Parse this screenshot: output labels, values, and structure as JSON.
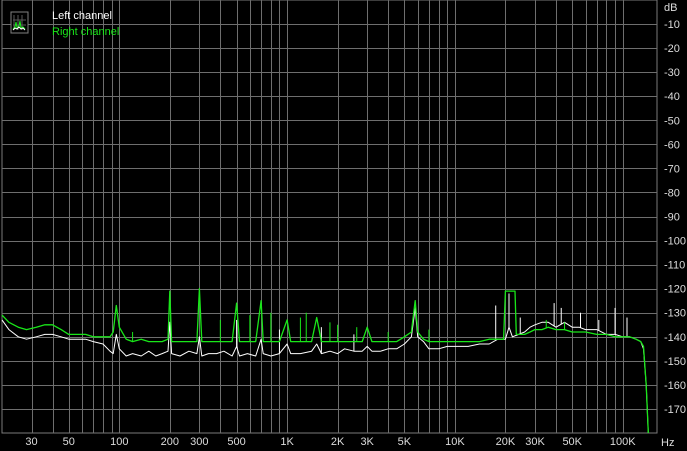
{
  "chart_data": {
    "type": "line",
    "x_scale": "log",
    "xlim": [
      20,
      160000
    ],
    "ylim": [
      -180,
      0
    ],
    "grid": true,
    "legend_placement": "top-left",
    "x_unit": "Hz",
    "y_unit": "dB",
    "x_ticks": [
      {
        "value": 30,
        "label": "30"
      },
      {
        "value": 50,
        "label": "50"
      },
      {
        "value": 100,
        "label": "100"
      },
      {
        "value": 200,
        "label": "200"
      },
      {
        "value": 300,
        "label": "300"
      },
      {
        "value": 500,
        "label": "500"
      },
      {
        "value": 1000,
        "label": "1K"
      },
      {
        "value": 2000,
        "label": "2K"
      },
      {
        "value": 3000,
        "label": "3K"
      },
      {
        "value": 5000,
        "label": "5K"
      },
      {
        "value": 10000,
        "label": "10K"
      },
      {
        "value": 20000,
        "label": "20K"
      },
      {
        "value": 30000,
        "label": "30K"
      },
      {
        "value": 50000,
        "label": "50K"
      },
      {
        "value": 100000,
        "label": "100K"
      }
    ],
    "y_ticks": [
      {
        "value": -10,
        "label": "-10"
      },
      {
        "value": -20,
        "label": "-20"
      },
      {
        "value": -30,
        "label": "-30"
      },
      {
        "value": -40,
        "label": "-40"
      },
      {
        "value": -50,
        "label": "-50"
      },
      {
        "value": -60,
        "label": "-60"
      },
      {
        "value": -70,
        "label": "-70"
      },
      {
        "value": -80,
        "label": "-80"
      },
      {
        "value": -90,
        "label": "-90"
      },
      {
        "value": -100,
        "label": "-100"
      },
      {
        "value": -110,
        "label": "-110"
      },
      {
        "value": -120,
        "label": "-120"
      },
      {
        "value": -130,
        "label": "-130"
      },
      {
        "value": -140,
        "label": "-140"
      },
      {
        "value": -150,
        "label": "-150"
      },
      {
        "value": -160,
        "label": "-160"
      },
      {
        "value": -170,
        "label": "-170"
      }
    ],
    "series": [
      {
        "name": "Left channel",
        "color": "#ffffff",
        "points": [
          [
            20,
            -133
          ],
          [
            22,
            -137
          ],
          [
            25,
            -140
          ],
          [
            28,
            -141
          ],
          [
            32,
            -140
          ],
          [
            36,
            -139
          ],
          [
            40,
            -139
          ],
          [
            45,
            -140
          ],
          [
            50,
            -141
          ],
          [
            56,
            -141
          ],
          [
            63,
            -141
          ],
          [
            70,
            -142
          ],
          [
            80,
            -143
          ],
          [
            88,
            -146
          ],
          [
            92,
            -147
          ],
          [
            96,
            -139
          ],
          [
            100,
            -145
          ],
          [
            110,
            -148
          ],
          [
            120,
            -147
          ],
          [
            135,
            -148
          ],
          [
            150,
            -146
          ],
          [
            165,
            -148
          ],
          [
            180,
            -147
          ],
          [
            195,
            -146
          ],
          [
            200,
            -134
          ],
          [
            205,
            -147
          ],
          [
            230,
            -148
          ],
          [
            260,
            -146
          ],
          [
            290,
            -147
          ],
          [
            300,
            -140
          ],
          [
            310,
            -148
          ],
          [
            340,
            -147
          ],
          [
            380,
            -147
          ],
          [
            420,
            -146
          ],
          [
            470,
            -148
          ],
          [
            500,
            -144
          ],
          [
            520,
            -148
          ],
          [
            580,
            -147
          ],
          [
            650,
            -148
          ],
          [
            700,
            -141
          ],
          [
            720,
            -147
          ],
          [
            800,
            -148
          ],
          [
            900,
            -147
          ],
          [
            1000,
            -143
          ],
          [
            1050,
            -147
          ],
          [
            1200,
            -147
          ],
          [
            1400,
            -146
          ],
          [
            1500,
            -143
          ],
          [
            1600,
            -147
          ],
          [
            1800,
            -146
          ],
          [
            2000,
            -147
          ],
          [
            2200,
            -145
          ],
          [
            2500,
            -146
          ],
          [
            2800,
            -146
          ],
          [
            3000,
            -144
          ],
          [
            3200,
            -146
          ],
          [
            3600,
            -146
          ],
          [
            4000,
            -145
          ],
          [
            4500,
            -145
          ],
          [
            5000,
            -143
          ],
          [
            5500,
            -140
          ],
          [
            5800,
            -128
          ],
          [
            6000,
            -140
          ],
          [
            6500,
            -142
          ],
          [
            7000,
            -145
          ],
          [
            8000,
            -145
          ],
          [
            9000,
            -144
          ],
          [
            10000,
            -144
          ],
          [
            12000,
            -144
          ],
          [
            14000,
            -143
          ],
          [
            16000,
            -143
          ],
          [
            18000,
            -141
          ],
          [
            20000,
            -141
          ],
          [
            21000,
            -136
          ],
          [
            22000,
            -140
          ],
          [
            24000,
            -139
          ],
          [
            26000,
            -138
          ],
          [
            28000,
            -136
          ],
          [
            30000,
            -135
          ],
          [
            33000,
            -134
          ],
          [
            36000,
            -134
          ],
          [
            40000,
            -136
          ],
          [
            45000,
            -134
          ],
          [
            50000,
            -136
          ],
          [
            55000,
            -136
          ],
          [
            60000,
            -137
          ],
          [
            70000,
            -137
          ],
          [
            80000,
            -139
          ],
          [
            90000,
            -139
          ],
          [
            100000,
            -140
          ],
          [
            110000,
            -140
          ],
          [
            120000,
            -141
          ],
          [
            128000,
            -142
          ],
          [
            133000,
            -145
          ],
          [
            138000,
            -160
          ],
          [
            142000,
            -180
          ]
        ],
        "spikes": [
          {
            "f": 500,
            "db": -133
          },
          {
            "f": 900,
            "db": -137
          },
          {
            "f": 1600,
            "db": -136
          },
          {
            "f": 2500,
            "db": -139
          },
          {
            "f": 5800,
            "db": -127
          },
          {
            "f": 17500,
            "db": -127
          },
          {
            "f": 21000,
            "db": -122
          },
          {
            "f": 24500,
            "db": -132
          },
          {
            "f": 39000,
            "db": -126
          },
          {
            "f": 43000,
            "db": -128
          },
          {
            "f": 56000,
            "db": -130
          },
          {
            "f": 72000,
            "db": -133
          },
          {
            "f": 90000,
            "db": -128
          },
          {
            "f": 106000,
            "db": -132
          }
        ]
      },
      {
        "name": "Right channel",
        "color": "#19e619",
        "points": [
          [
            20,
            -131
          ],
          [
            22,
            -134
          ],
          [
            25,
            -136
          ],
          [
            28,
            -137
          ],
          [
            32,
            -136
          ],
          [
            36,
            -135
          ],
          [
            40,
            -135
          ],
          [
            45,
            -137
          ],
          [
            50,
            -139
          ],
          [
            56,
            -139
          ],
          [
            63,
            -139
          ],
          [
            70,
            -140
          ],
          [
            80,
            -140
          ],
          [
            88,
            -140
          ],
          [
            92,
            -138
          ],
          [
            96,
            -127
          ],
          [
            100,
            -136
          ],
          [
            110,
            -141
          ],
          [
            120,
            -142
          ],
          [
            135,
            -141
          ],
          [
            150,
            -142
          ],
          [
            165,
            -142
          ],
          [
            180,
            -142
          ],
          [
            195,
            -141
          ],
          [
            200,
            -121
          ],
          [
            205,
            -142
          ],
          [
            230,
            -142
          ],
          [
            260,
            -142
          ],
          [
            290,
            -142
          ],
          [
            300,
            -120
          ],
          [
            310,
            -142
          ],
          [
            340,
            -142
          ],
          [
            380,
            -142
          ],
          [
            420,
            -142
          ],
          [
            470,
            -142
          ],
          [
            500,
            -126
          ],
          [
            520,
            -142
          ],
          [
            580,
            -142
          ],
          [
            650,
            -142
          ],
          [
            700,
            -125
          ],
          [
            720,
            -142
          ],
          [
            800,
            -142
          ],
          [
            900,
            -142
          ],
          [
            1000,
            -133
          ],
          [
            1050,
            -142
          ],
          [
            1200,
            -142
          ],
          [
            1400,
            -142
          ],
          [
            1500,
            -132
          ],
          [
            1600,
            -142
          ],
          [
            1800,
            -142
          ],
          [
            2000,
            -142
          ],
          [
            2200,
            -142
          ],
          [
            2500,
            -142
          ],
          [
            2800,
            -142
          ],
          [
            3000,
            -136
          ],
          [
            3200,
            -142
          ],
          [
            3600,
            -142
          ],
          [
            4000,
            -142
          ],
          [
            4500,
            -142
          ],
          [
            5000,
            -140
          ],
          [
            5500,
            -138
          ],
          [
            5800,
            -125
          ],
          [
            6000,
            -138
          ],
          [
            6500,
            -141
          ],
          [
            7000,
            -142
          ],
          [
            8000,
            -142
          ],
          [
            9000,
            -142
          ],
          [
            10000,
            -142
          ],
          [
            12000,
            -142
          ],
          [
            14000,
            -142
          ],
          [
            16000,
            -141
          ],
          [
            18000,
            -141
          ],
          [
            19500,
            -141
          ],
          [
            20000,
            -121
          ],
          [
            22000,
            -121
          ],
          [
            22800,
            -121
          ],
          [
            23200,
            -139
          ],
          [
            26000,
            -139
          ],
          [
            28000,
            -138
          ],
          [
            30000,
            -137
          ],
          [
            33000,
            -137
          ],
          [
            36000,
            -136
          ],
          [
            40000,
            -137
          ],
          [
            45000,
            -137
          ],
          [
            50000,
            -138
          ],
          [
            55000,
            -138
          ],
          [
            60000,
            -138
          ],
          [
            70000,
            -139
          ],
          [
            80000,
            -139
          ],
          [
            90000,
            -140
          ],
          [
            100000,
            -140
          ],
          [
            110000,
            -140
          ],
          [
            120000,
            -141
          ],
          [
            128000,
            -142
          ],
          [
            133000,
            -144
          ],
          [
            138000,
            -160
          ],
          [
            142000,
            -180
          ]
        ],
        "spikes": [
          {
            "f": 120,
            "db": -138
          },
          {
            "f": 400,
            "db": -133
          },
          {
            "f": 600,
            "db": -131
          },
          {
            "f": 800,
            "db": -130
          },
          {
            "f": 1200,
            "db": -132
          },
          {
            "f": 1300,
            "db": -130
          },
          {
            "f": 1800,
            "db": -134
          },
          {
            "f": 2000,
            "db": -135
          },
          {
            "f": 2600,
            "db": -136
          },
          {
            "f": 4000,
            "db": -138
          },
          {
            "f": 7000,
            "db": -137
          },
          {
            "f": 35000,
            "db": -133
          },
          {
            "f": 45000,
            "db": -134
          }
        ]
      }
    ]
  }
}
